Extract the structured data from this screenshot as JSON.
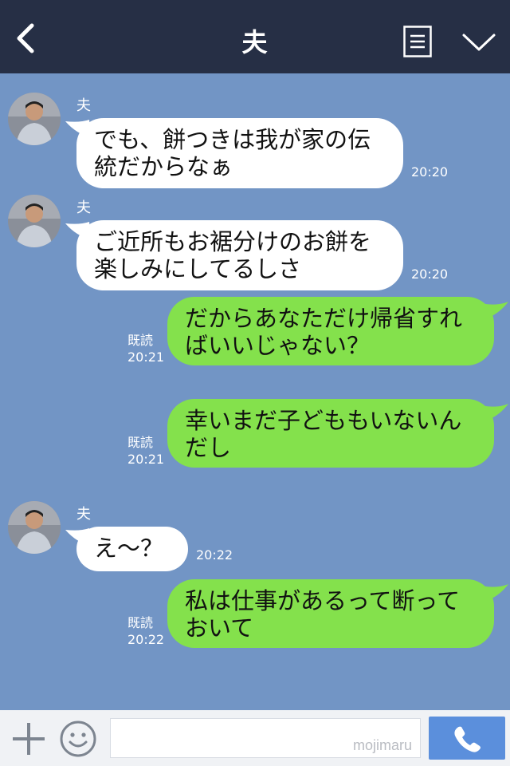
{
  "header": {
    "title": "夫",
    "icons": [
      "chevron-left-icon",
      "list-icon",
      "chevron-down-icon"
    ]
  },
  "messages": [
    {
      "side": "in",
      "sender": "夫",
      "lines": [
        "でも、餅つきは我が家の伝",
        "統だからなぁ"
      ],
      "time": "20:20"
    },
    {
      "side": "in",
      "sender": "夫",
      "lines": [
        "ご近所もお裾分けのお餅を",
        "楽しみにしてるしさ"
      ],
      "time": "20:20"
    },
    {
      "side": "out",
      "read": "既読",
      "lines": [
        "だからあなただけ帰省すれ",
        "ばいいじゃない？"
      ],
      "time": "20:21"
    },
    {
      "side": "out",
      "read": "既読",
      "lines": [
        "幸いまだ子どももいないん",
        "だし"
      ],
      "time": "20:21"
    },
    {
      "side": "in",
      "sender": "夫",
      "lines": [
        "え〜？"
      ],
      "time": "20:22"
    },
    {
      "side": "out",
      "read": "既読",
      "lines": [
        "私は仕事があるって断って",
        "おいて"
      ],
      "time": "20:22"
    }
  ],
  "footer": {
    "input_placeholder": "",
    "watermark": "mojimaru",
    "icons": [
      "plus-icon",
      "smiley-icon",
      "phone-icon"
    ]
  },
  "colors": {
    "header": "#262f45",
    "background": "#7295c5",
    "outgoing_bubble": "#84e14c",
    "incoming_bubble": "#ffffff",
    "call_button": "#5b8fdc"
  }
}
